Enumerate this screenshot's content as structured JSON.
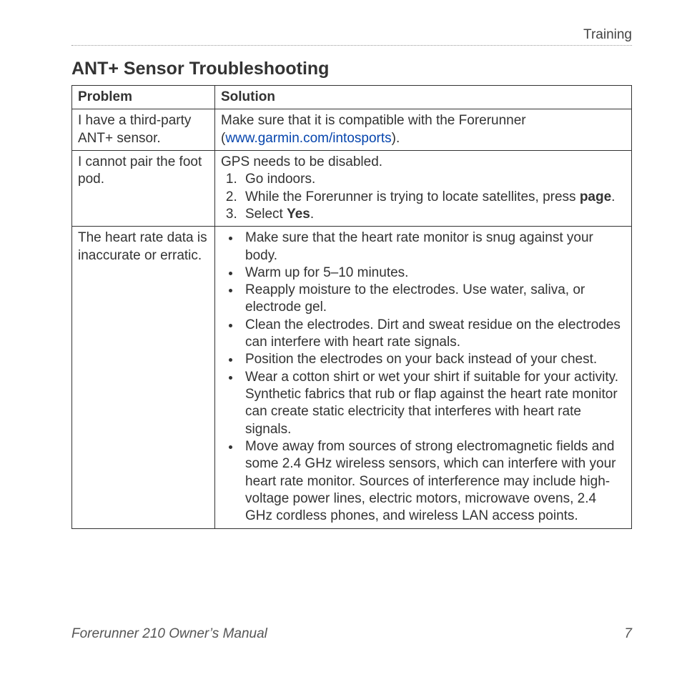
{
  "header": {
    "section": "Training"
  },
  "title": "ANT+ Sensor Troubleshooting",
  "table": {
    "headers": {
      "problem": "Problem",
      "solution": "Solution"
    },
    "rows": [
      {
        "problem": "I have a third-party ANT+ sensor.",
        "solution": {
          "intro_pre": "Make sure that it is compatible with the Forerunner (",
          "link": "www.garmin.com/intosports",
          "intro_post": ")."
        }
      },
      {
        "problem": "I cannot pair the foot pod.",
        "solution": {
          "pre": "GPS needs to be disabled.",
          "steps": [
            {
              "text": "Go indoors."
            },
            {
              "pre": "While the Forerunner is trying to locate satellites, press ",
              "bold": "page",
              "post": "."
            },
            {
              "pre": "Select ",
              "bold": "Yes",
              "post": "."
            }
          ]
        }
      },
      {
        "problem": "The heart rate data is inaccurate or erratic.",
        "solution": {
          "bullets": [
            "Make sure that the heart rate monitor is snug against your body.",
            "Warm up for 5–10 minutes.",
            "Reapply moisture to the electrodes. Use water, saliva, or electrode gel.",
            "Clean the electrodes. Dirt and sweat residue on the electrodes can interfere with heart rate signals.",
            "Position the electrodes on your back instead of your chest.",
            "Wear a cotton shirt or wet your shirt if suitable for your activity. Synthetic fabrics that rub or flap against the heart rate monitor can create static electricity that interferes with heart rate signals.",
            "Move away from sources of strong electromagnetic fields and some 2.4 GHz wireless sensors, which can interfere with your heart rate monitor. Sources of interference may include high-voltage power lines, electric motors, microwave ovens, 2.4 GHz cordless phones, and wireless LAN access points."
          ]
        }
      }
    ]
  },
  "footer": {
    "title": "Forerunner 210 Owner’s Manual",
    "page": "7"
  }
}
